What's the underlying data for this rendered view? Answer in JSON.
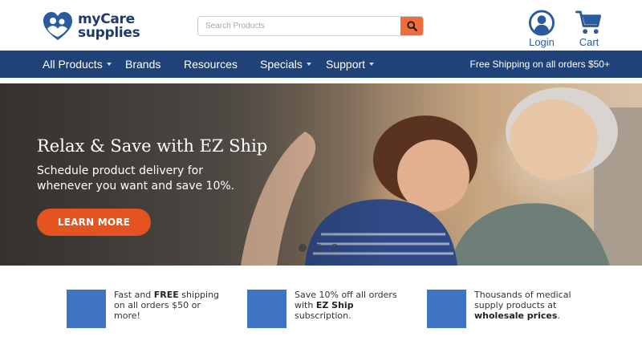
{
  "logo": {
    "line1": "myCare",
    "line2": "supplies"
  },
  "search": {
    "placeholder": "Search Products",
    "value": ""
  },
  "header_links": {
    "login": "Login",
    "cart": "Cart"
  },
  "nav": {
    "items": [
      {
        "label": "All Products",
        "dropdown": true
      },
      {
        "label": "Brands",
        "dropdown": false
      },
      {
        "label": "Resources",
        "dropdown": false
      },
      {
        "label": "Specials",
        "dropdown": true
      },
      {
        "label": "Support",
        "dropdown": true
      }
    ],
    "shipping_note": "Free Shipping on all orders $50+"
  },
  "hero": {
    "title": "Relax & Save with EZ Ship",
    "subtitle": "Schedule product delivery for whenever you want and save 10%.",
    "button": "LEARN MORE",
    "slides": 3,
    "active_slide": 1
  },
  "features": [
    {
      "pre": "Fast and ",
      "bold": "FREE",
      "post": " shipping on all orders $50 or more!"
    },
    {
      "pre": "Save 10% off all orders with ",
      "bold": "EZ Ship",
      "post": " subscription."
    },
    {
      "pre": "Thousands of medical supply products at ",
      "bold": "wholesale prices",
      "post": "."
    }
  ],
  "colors": {
    "brand_navy": "#1f4278",
    "logo_blue": "#2a5b9f",
    "accent_orange": "#e55320",
    "search_orange": "#ee6c3a",
    "feature_blue": "#3e74c2"
  },
  "icons": {
    "logo": "heart-people-icon",
    "search": "search-icon",
    "login": "user-circle-icon",
    "cart": "shopping-cart-icon"
  }
}
